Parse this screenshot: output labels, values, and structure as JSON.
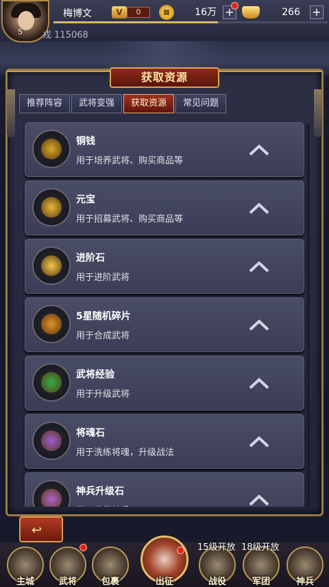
{
  "player": {
    "name": "梅博文",
    "level": "5",
    "vip": "V",
    "vip_level": "0",
    "power": "115068",
    "power_label": "戎"
  },
  "currency": {
    "coins": "16万",
    "ingots": "266",
    "plus": "+"
  },
  "panel": {
    "title": "获取资源"
  },
  "tabs": [
    {
      "label": "推荐阵容",
      "active": false
    },
    {
      "label": "武将变强",
      "active": false
    },
    {
      "label": "获取资源",
      "active": true
    },
    {
      "label": "常见问题",
      "active": false
    }
  ],
  "items": [
    {
      "title": "铜钱",
      "desc": "用于培养武将、购买商品等",
      "icon": "copper-coin-icon",
      "color": "#d9a82a"
    },
    {
      "title": "元宝",
      "desc": "用于招募武将、购买商品等",
      "icon": "gold-ingot-icon",
      "color": "#e8b93a"
    },
    {
      "title": "进阶石",
      "desc": "用于进阶武将",
      "icon": "advance-stone-icon",
      "color": "#f0c84a"
    },
    {
      "title": "5星随机碎片",
      "desc": "用于合成武将",
      "icon": "fragment-icon",
      "color": "#e0902a"
    },
    {
      "title": "武将经验",
      "desc": "用于升级武将",
      "icon": "exp-orb-icon",
      "color": "#2fae4a"
    },
    {
      "title": "将魂石",
      "desc": "用于洗练将魂，升级战法",
      "icon": "soul-stone-icon",
      "color": "#9a5ad8"
    },
    {
      "title": "神兵升级石",
      "desc": "用于升级神兵",
      "icon": "weapon-stone-icon",
      "color": "#b060d0"
    }
  ],
  "back": {
    "label": "↩"
  },
  "nav": [
    {
      "label": "主城"
    },
    {
      "label": "武将"
    },
    {
      "label": "包裹"
    },
    {
      "label": "出征"
    },
    {
      "label": "战役"
    },
    {
      "label": "军团"
    },
    {
      "label": "神兵"
    }
  ],
  "locks": [
    "15级开放",
    "18级开放"
  ]
}
